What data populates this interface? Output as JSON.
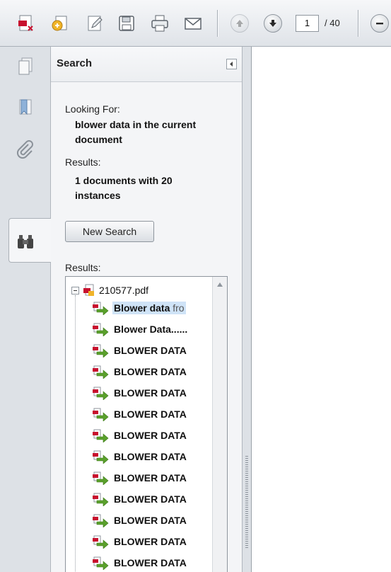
{
  "toolbar": {
    "buttons": [
      {
        "name": "create-pdf-icon"
      },
      {
        "name": "combine-icon"
      },
      {
        "name": "edit-icon"
      },
      {
        "name": "save-icon"
      },
      {
        "name": "print-icon"
      },
      {
        "name": "email-icon"
      }
    ],
    "current_page": "1",
    "page_total": "/ 40"
  },
  "rail": {
    "icons": [
      "pages-icon",
      "bookmarks-icon",
      "attachments-icon",
      "search-binoculars-icon"
    ],
    "active": "search-binoculars-icon"
  },
  "search_pane": {
    "title": "Search",
    "looking_for_label": "Looking For:",
    "query_line1": "blower data in the current",
    "query_line2": "document",
    "results_label": "Results:",
    "summary_line1": "1 documents with 20",
    "summary_line2": "instances",
    "new_search_label": "New Search",
    "results_list_label": "Results:",
    "root_file": "210577.pdf",
    "results": [
      {
        "text": "Blower data",
        "tail": " fro",
        "selected": true
      },
      {
        "text": "Blower Data......",
        "tail": ""
      },
      {
        "text": "BLOWER DATA",
        "tail": ""
      },
      {
        "text": "BLOWER DATA",
        "tail": ""
      },
      {
        "text": "BLOWER DATA",
        "tail": ""
      },
      {
        "text": "BLOWER DATA",
        "tail": ""
      },
      {
        "text": "BLOWER DATA",
        "tail": ""
      },
      {
        "text": "BLOWER DATA",
        "tail": ""
      },
      {
        "text": "BLOWER DATA",
        "tail": ""
      },
      {
        "text": "BLOWER DATA",
        "tail": ""
      },
      {
        "text": "BLOWER DATA",
        "tail": ""
      },
      {
        "text": "BLOWER DATA",
        "tail": ""
      },
      {
        "text": "BLOWER DATA",
        "tail": ""
      }
    ]
  },
  "colors": {
    "selection": "#cfe3f7",
    "pdf_red": "#c8102e",
    "arrow_green": "#5aa02c"
  }
}
